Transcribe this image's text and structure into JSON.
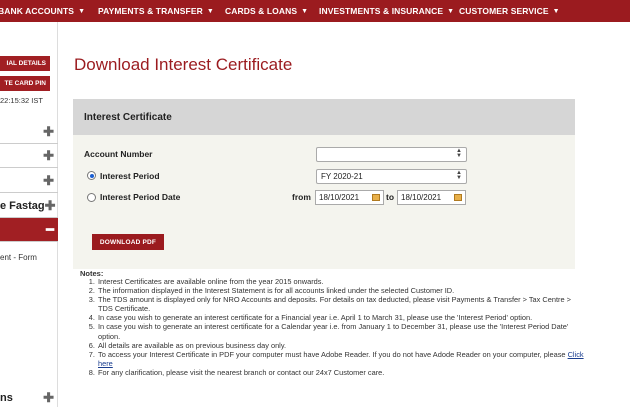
{
  "topnav": {
    "items": [
      {
        "label": "BANK ACCOUNTS"
      },
      {
        "label": "PAYMENTS & TRANSFER"
      },
      {
        "label": "CARDS & LOANS"
      },
      {
        "label": "INVESTMENTS & INSURANCE"
      },
      {
        "label": "CUSTOMER SERVICE"
      }
    ]
  },
  "sidebar": {
    "buttons": [
      "IAL DETAILS",
      "TE CARD PIN"
    ],
    "time": "22:15:32 IST",
    "rows": [
      {
        "label": ""
      },
      {
        "label": ""
      },
      {
        "label": ""
      },
      {
        "label": "e Fastag"
      },
      {
        "label": ""
      }
    ],
    "sub_item": "ent - Form",
    "bottom_label": "ns"
  },
  "page": {
    "title": "Download Interest Certificate"
  },
  "form": {
    "header": "Interest Certificate",
    "account_label": "Account Number",
    "account_value": "",
    "period_label": "Interest Period",
    "period_value": "FY 2020-21",
    "period_date_label": "Interest Period Date",
    "from_label": "from",
    "from_value": "18/10/2021",
    "to_label": "to",
    "to_value": "18/10/2021",
    "selected_option": "Interest Period",
    "download_label": "DOWNLOAD PDF"
  },
  "notes": {
    "title": "Notes:",
    "items": [
      "Interest Certificates are available online from the year 2015 onwards.",
      "The information displayed in the Interest Statement is for all accounts linked under the selected Customer ID.",
      "The TDS amount is displayed only for NRO Accounts and deposits. For details on tax deducted, please visit Payments & Transfer > Tax Centre > TDS Certificate.",
      "In case you wish to generate an interest certificate for a Financial year i.e. April 1 to March 31, please use the 'Interest Period' option.",
      "In case you wish to generate an interest certificate for a Calendar year i.e. from January 1 to December 31, please use the 'Interest Period Date' option.",
      "All details are available as on previous business day only.",
      "To access your Interest Certificate in PDF your computer must have Adobe Reader. If you do not have Adode Reader on your computer, please",
      "For any clarification, please visit the nearest branch or contact our 24x7 Customer care."
    ],
    "link_text": "Click here"
  },
  "colors": {
    "brand": "#9b1b1f",
    "radio_on": "#1a5fd1"
  }
}
